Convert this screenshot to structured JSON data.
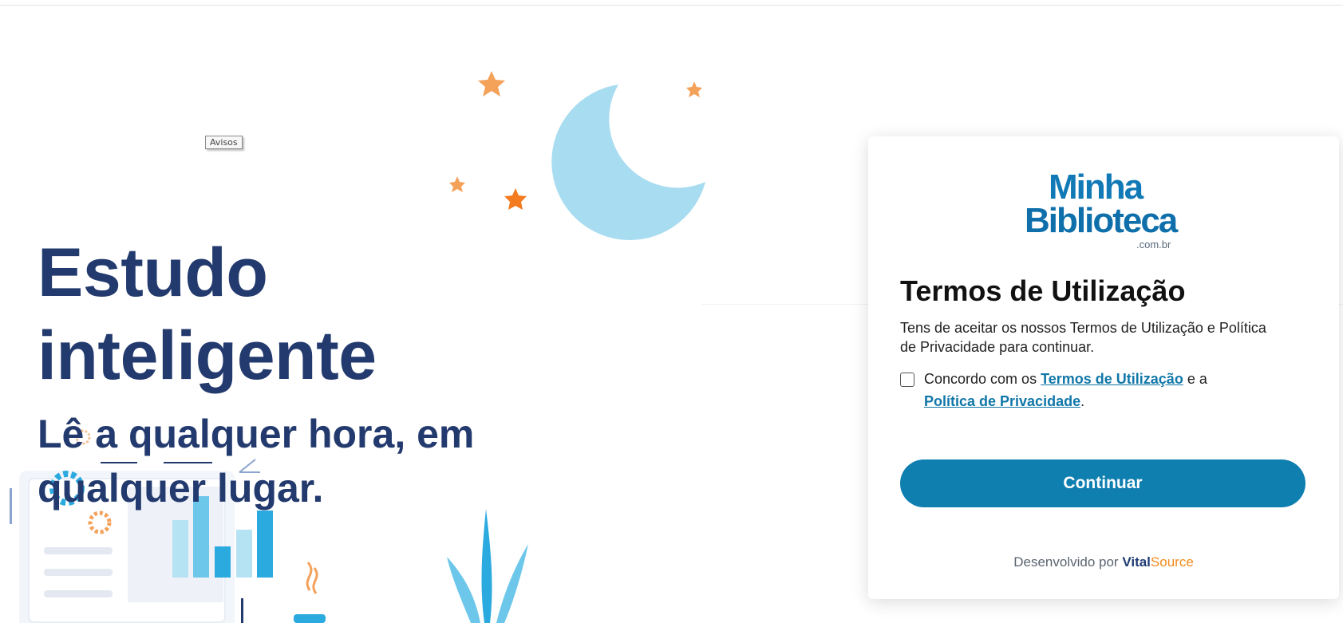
{
  "notice_tab": "Avisos",
  "hero": {
    "title_line1": "Estudo",
    "title_line2": "inteligente",
    "subtitle": "Lê a qualquer hora, em qualquer lugar."
  },
  "card": {
    "logo": {
      "line1": "Minha",
      "line2": "Biblioteca",
      "domain": ".com.br"
    },
    "title": "Termos de Utilização",
    "description": "Tens de aceitar os nossos Termos de Utilização e Política de Privacidade para continuar.",
    "consent": {
      "prefix": "Concordo com os",
      "terms_link": "Termos de Utilização",
      "connector": "e a",
      "privacy_link": "Política de Privacidade",
      "suffix": ".",
      "checked": false
    },
    "continue_button": "Continuar",
    "powered_by": {
      "label": "Desenvolvido por",
      "brand_part1": "Vital",
      "brand_part2": "Source"
    }
  },
  "colors": {
    "hero_text": "#233a6e",
    "accent_button": "#0f7fb0",
    "link": "#1077a8",
    "moon": "#a8dcf0",
    "stars": "#f4a15a"
  },
  "icons": [
    "moon-illustration",
    "star-icon",
    "gear-icon",
    "bar-chart-illustration",
    "plant-illustration",
    "coffee-steam-icon"
  ]
}
